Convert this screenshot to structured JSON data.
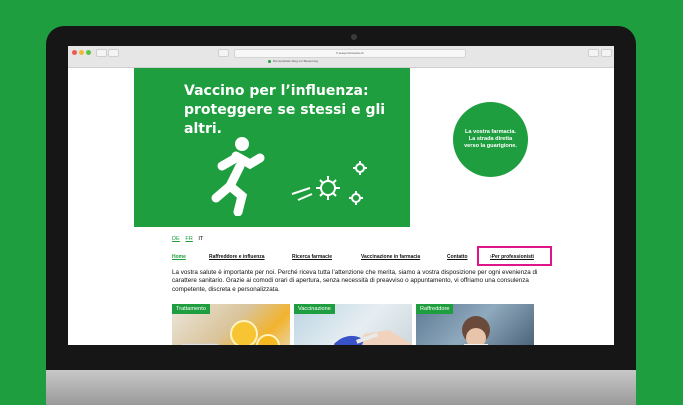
{
  "browser": {
    "url": "fr.sesqui.farmacia.ch",
    "bookmark": "Die Apotheke Weg zur Besserung"
  },
  "hero": {
    "title": "Vaccino per l’influenza:\nproteggere se stessi e gli altri."
  },
  "badge": {
    "text": "La vostra farmacia.\nLa strada diretta\nverso la guarigione."
  },
  "languages": [
    {
      "label": "DE"
    },
    {
      "label": "FR"
    },
    {
      "label": "IT"
    }
  ],
  "nav": {
    "items": [
      {
        "label": "Home"
      },
      {
        "label": "Raffreddore e influenza"
      },
      {
        "label": "Ricerca farmacie"
      },
      {
        "label": "Vaccinazione in farmacia"
      },
      {
        "label": "Contatto"
      },
      {
        "label": "›Per professionisti"
      }
    ]
  },
  "intro": "La vostra salute è importante per noi. Perché riceva tutta l’attenzione che merita, siamo a vostra disposizione per ogni evenienza di carattere sanitario. Grazie ai comodi orari di apertura, senza necessità di preavviso o appuntamento, vi offriamo una consulenza competente, discreta e personalizzata.",
  "cards": [
    {
      "label": "Trattamento"
    },
    {
      "label": "Vaccinazione"
    },
    {
      "label": "Raffreddore"
    }
  ],
  "colors": {
    "brand_green": "#1f9e3f",
    "highlight_pink": "#e0158a"
  }
}
